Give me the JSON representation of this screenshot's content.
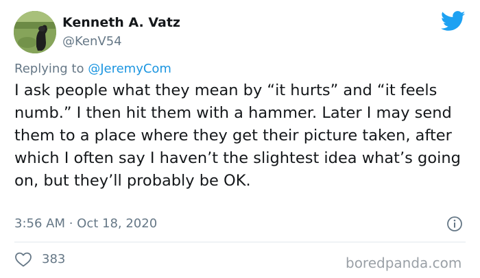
{
  "author": {
    "name": "Kenneth A. Vatz",
    "handle": "@KenV54"
  },
  "reply": {
    "prefix": "Replying to ",
    "user": "@JeremyCom"
  },
  "tweet": {
    "text": "I ask people what they mean by “it hurts” and “it feels numb.” I then hit them with a hammer. Later I may send them to a place where they get their picture taken, after which I often say I haven’t the slightest idea what’s going on, but they’ll probably be OK.",
    "timestamp": "3:56 AM · Oct 18, 2020",
    "likes": "383"
  },
  "watermark": "boredpanda.com",
  "icons": {
    "brand": "twitter-bird-icon",
    "info": "info-icon",
    "like": "heart-icon"
  },
  "colors": {
    "twitter_blue": "#1da1f2",
    "link_blue": "#1b95e0",
    "secondary_text": "#657786",
    "primary_text": "#14171a"
  }
}
